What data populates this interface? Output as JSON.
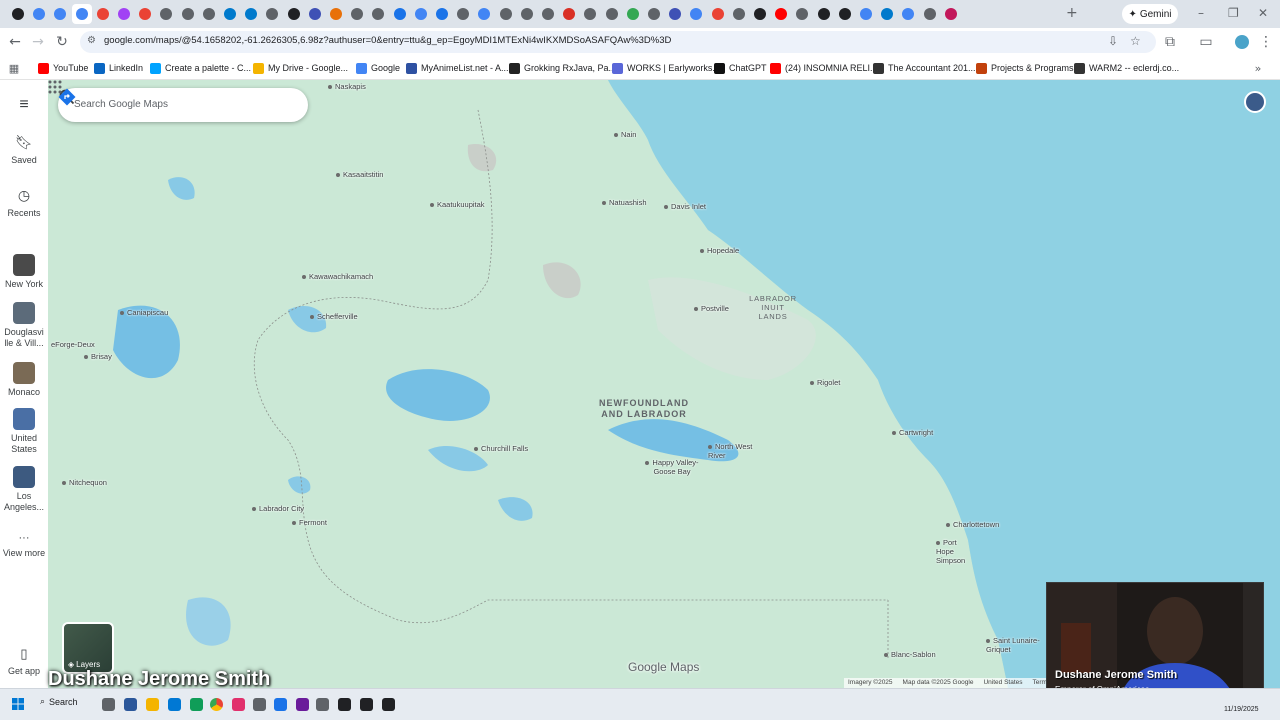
{
  "browser": {
    "url": "google.com/maps/@54.1658202,-61.2626305,6.98z?authuser=0&entry=ttu&g_ep=EgoyMDI1MTExNi4wIKXMDSoASAFQAw%3D%3D",
    "gemini_label": "Gemini",
    "new_tab_symbol": "+",
    "bookmarks": [
      {
        "label": "YouTube",
        "color": "#ff0000"
      },
      {
        "label": "LinkedIn",
        "color": "#0a66c2"
      },
      {
        "label": "Create a palette - C...",
        "color": "#00a3ff"
      },
      {
        "label": "My Drive - Google...",
        "color": "#f4b400"
      },
      {
        "label": "Google",
        "color": "#4285f4"
      },
      {
        "label": "MyAnimeList.net - A...",
        "color": "#2e51a2"
      },
      {
        "label": "Grokking RxJava, Pa...",
        "color": "#222222"
      },
      {
        "label": "WORKS | Earlyworks...",
        "color": "#5a67d8"
      },
      {
        "label": "ChatGPT",
        "color": "#111111"
      },
      {
        "label": "(24) INSOMNIA RELI...",
        "color": "#ff0000"
      },
      {
        "label": "The Accountant 201...",
        "color": "#333333"
      },
      {
        "label": "Projects & Programs",
        "color": "#c2410c"
      },
      {
        "label": "WARM2 -- eclerdj.co...",
        "color": "#333333"
      }
    ]
  },
  "maps": {
    "search_placeholder": "Search Google Maps",
    "rail": {
      "saved": "Saved",
      "recents": "Recents",
      "recent_places": [
        {
          "label": "New York",
          "color": "#4a4a4a"
        },
        {
          "label": "Douglasvi lle & Vill...",
          "color": "#5c6b7a"
        },
        {
          "label": "Monaco",
          "color": "#7a6a55"
        },
        {
          "label": "United States",
          "color": "#4a6fa5"
        },
        {
          "label": "Los Angeles...",
          "color": "#3d5a80"
        }
      ],
      "view_more": "View more",
      "get_app": "Get app"
    },
    "layers_label": "Layers",
    "region_label": "NEWFOUNDLAND AND LABRADOR",
    "inuit_label": "LABRADOR INUIT LANDS",
    "places": {
      "naskapis": "Naskapis",
      "kawawachikamach_top": "Kawawachikamach",
      "kaatukuupitak": "Kaatukuupitak",
      "kasaaitstitin": "Kasaaitstitin",
      "nain": "Nain",
      "natuashish": "Natuashish",
      "davis_inlet": "Davis Inlet",
      "hopedale": "Hopedale",
      "kawawachikamach": "Kawawachikamach",
      "schefferville": "Schefferville",
      "postville": "Postville",
      "caniapiscau": "Caniapiscau",
      "forge_deux": "eForge-Deux",
      "brisay": "Brisay",
      "rigolet": "Rigolet",
      "cartwright": "Cartwright",
      "churchill_falls": "Churchill Falls",
      "north_west_river": "North West River",
      "happy_valley": "Happy Valley-Goose Bay",
      "nitchequon": "Nitchequon",
      "labrador_city": "Labrador City",
      "fermont": "Fermont",
      "charlottetown": "Charlottetown",
      "port_hope_simpson": "Port Hope Simpson",
      "saint_lunaire": "Saint Lunaire-Griquet",
      "blanc_sablon": "Blanc-Sablon"
    },
    "logo": "Google Maps",
    "footer": [
      "Imagery ©2025",
      "Map data ©2025 Google",
      "United States",
      "Terms"
    ]
  },
  "overlay": {
    "name": "Dushane Jerome Smith",
    "webcam_name": "Dushane Jerome Smith",
    "webcam_subtitle": "Emperor of OmniAmericas"
  },
  "taskbar": {
    "search_label": "Search",
    "date": "11/19/2025"
  }
}
